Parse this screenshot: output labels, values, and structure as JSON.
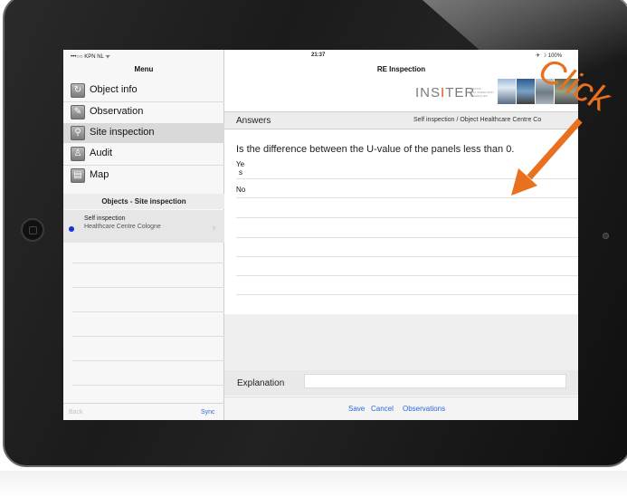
{
  "status_bar": {
    "carrier": "•••○○ KPN NL ᯤ",
    "time": "21:37",
    "battery": "✈ ☽ 100%"
  },
  "sidebar": {
    "title": "Menu",
    "items": [
      {
        "label": "Object info",
        "icon": "object-info-icon",
        "glyph": "↻"
      },
      {
        "label": "Observation",
        "icon": "pencil-icon",
        "glyph": "✎"
      },
      {
        "label": "Site inspection",
        "icon": "magnifier-icon",
        "glyph": "⚲"
      },
      {
        "label": "Audit",
        "icon": "stamp-icon",
        "glyph": "♙"
      },
      {
        "label": "Map",
        "icon": "map-icon",
        "glyph": "▤"
      }
    ],
    "objects_header": "Objects - Site inspection",
    "object": {
      "type": "Self inspection",
      "name": "Healthcare Centre Cologne",
      "chevron": "›"
    },
    "back_label": "Back",
    "sync_label": "Sync"
  },
  "main": {
    "title": "RE Inspection",
    "logo": {
      "prefix": "INS",
      "highlight": "I",
      "suffix": "TER",
      "tagline": [
        "REMOTE",
        "SELF INSPECTION",
        "TECHNIQUES"
      ]
    },
    "answers_label": "Answers",
    "answers_path": "Self inspection / Object Healthcare Centre Co",
    "question": "Is the difference between the U-value of the panels less than 0.",
    "options": {
      "yes_part1": "Ye",
      "yes_part2": "s",
      "no": "No"
    },
    "explanation_label": "Explanation",
    "explanation_value": "",
    "footer": {
      "save": "Save",
      "cancel": "Cancel",
      "observations": "Observations"
    }
  },
  "annotation": {
    "text": "Click",
    "color": "#e8701e"
  }
}
